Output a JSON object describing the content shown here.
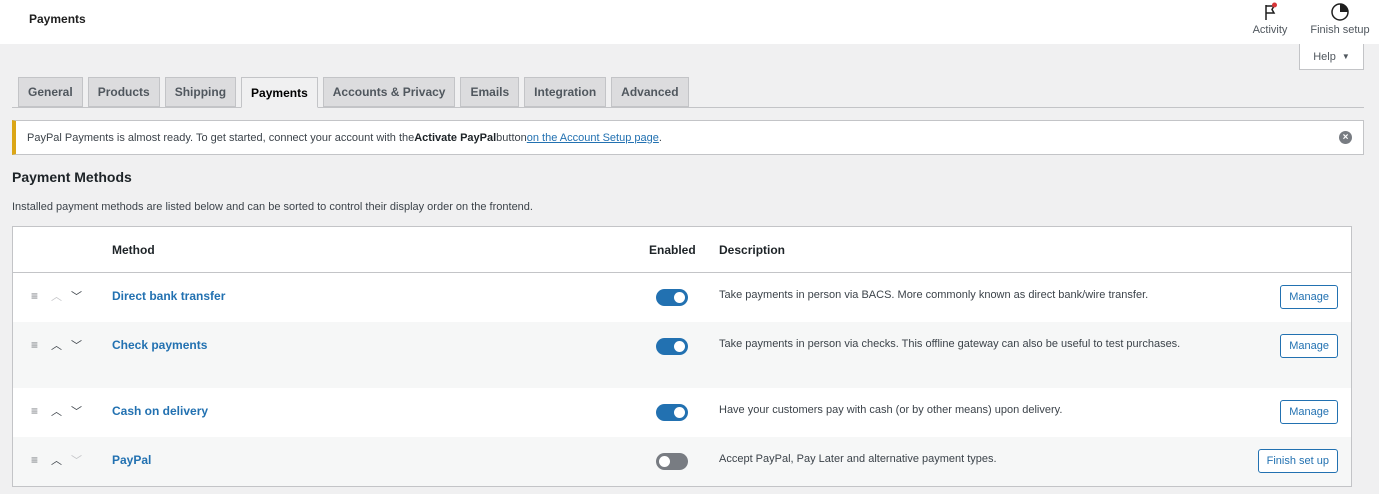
{
  "header": {
    "title": "Payments",
    "activity_label": "Activity",
    "activity_icon": "flag-icon",
    "finish_setup_label": "Finish setup",
    "finish_setup_icon": "progress-circle-icon",
    "help_label": "Help"
  },
  "tabs": [
    {
      "label": "General",
      "active": false
    },
    {
      "label": "Products",
      "active": false
    },
    {
      "label": "Shipping",
      "active": false
    },
    {
      "label": "Payments",
      "active": true
    },
    {
      "label": "Accounts & Privacy",
      "active": false
    },
    {
      "label": "Emails",
      "active": false
    },
    {
      "label": "Integration",
      "active": false
    },
    {
      "label": "Advanced",
      "active": false
    }
  ],
  "notice": {
    "text_before": "PayPal Payments is almost ready. To get started, connect your account with the ",
    "bold": "Activate PayPal",
    "text_middle": " button ",
    "link": "on the Account Setup page",
    "text_after": "."
  },
  "section": {
    "title": "Payment Methods",
    "description": "Installed payment methods are listed below and can be sorted to control their display order on the frontend."
  },
  "table": {
    "headers": {
      "method": "Method",
      "enabled": "Enabled",
      "description": "Description"
    },
    "rows": [
      {
        "method": "Direct bank transfer",
        "enabled": true,
        "description": "Take payments in person via BACS. More commonly known as direct bank/wire transfer.",
        "action": "Manage",
        "up_disabled": true,
        "down_disabled": false
      },
      {
        "method": "Check payments",
        "enabled": true,
        "description": "Take payments in person via checks. This offline gateway can also be useful to test purchases.",
        "action": "Manage",
        "up_disabled": false,
        "down_disabled": false
      },
      {
        "method": "Cash on delivery",
        "enabled": true,
        "description": "Have your customers pay with cash (or by other means) upon delivery.",
        "action": "Manage",
        "up_disabled": false,
        "down_disabled": false
      },
      {
        "method": "PayPal",
        "enabled": false,
        "description": "Accept PayPal, Pay Later and alternative payment types.",
        "action": "Finish set up",
        "up_disabled": false,
        "down_disabled": true
      }
    ]
  },
  "colors": {
    "accent": "#2271b1",
    "notice_border": "#dba617",
    "activity_dot": "#d63638"
  }
}
